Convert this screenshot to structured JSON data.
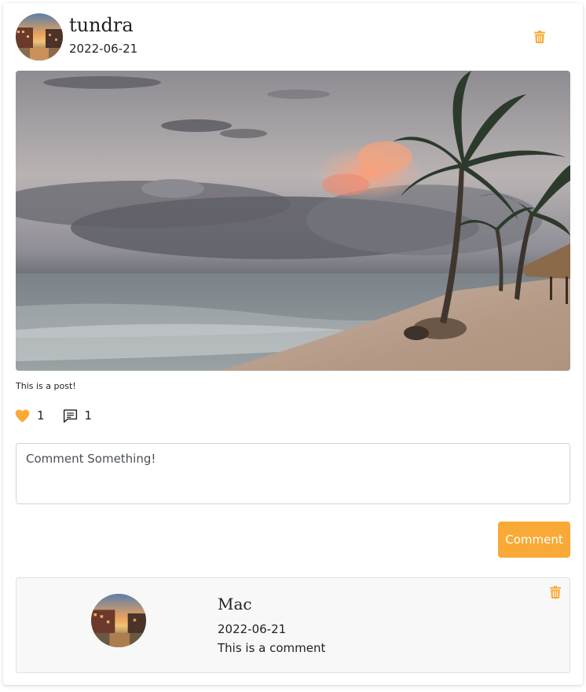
{
  "post": {
    "author": "tundra",
    "date": "2022-06-21",
    "caption": "This is a post!",
    "likes": "1",
    "comments_count": "1",
    "avatar_alt": "city canal at sunset",
    "image_alt": "beach with palm trees under cloudy sky"
  },
  "comment_form": {
    "placeholder": "Comment Something!",
    "button_label": "Comment"
  },
  "comments": [
    {
      "author": "Mac",
      "date": "2022-06-21",
      "text": "This is a comment"
    }
  ],
  "icons": {
    "delete": "trash-icon",
    "like": "heart-icon",
    "comment": "comment-icon"
  },
  "colors": {
    "accent": "#f9a935",
    "text": "#222222",
    "comment_bg": "#f8f8f8"
  }
}
